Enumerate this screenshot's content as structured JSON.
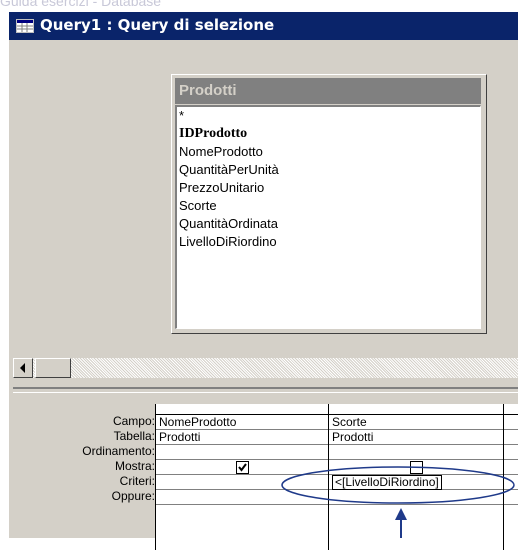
{
  "background_title": "Guida esercizi - Database",
  "window": {
    "title": "Query1 : Query di selezione"
  },
  "table": {
    "name": "Prodotti",
    "fields": [
      {
        "label": "*",
        "key": false
      },
      {
        "label": "IDProdotto",
        "key": true
      },
      {
        "label": "NomeProdotto",
        "key": false
      },
      {
        "label": "QuantitàPerUnità",
        "key": false
      },
      {
        "label": "PrezzoUnitario",
        "key": false
      },
      {
        "label": "Scorte",
        "key": false
      },
      {
        "label": "QuantitàOrdinata",
        "key": false
      },
      {
        "label": "LivelloDiRiordino",
        "key": false
      }
    ]
  },
  "grid": {
    "row_labels": {
      "campo": "Campo:",
      "tabella": "Tabella:",
      "ordinamento": "Ordinamento:",
      "mostra": "Mostra:",
      "criteri": "Criteri:",
      "oppure": "Oppure:"
    },
    "columns": [
      {
        "campo": "NomeProdotto",
        "tabella": "Prodotti",
        "ordinamento": "",
        "mostra": true,
        "criteri": "",
        "oppure": ""
      },
      {
        "campo": "Scorte",
        "tabella": "Prodotti",
        "ordinamento": "",
        "mostra": false,
        "criteri": "<[LivelloDiRiordino]",
        "oppure": ""
      }
    ]
  },
  "colors": {
    "titlebar": "#0a246a",
    "window_face": "#d4d0c8",
    "annotation": "#1f3a8a"
  }
}
